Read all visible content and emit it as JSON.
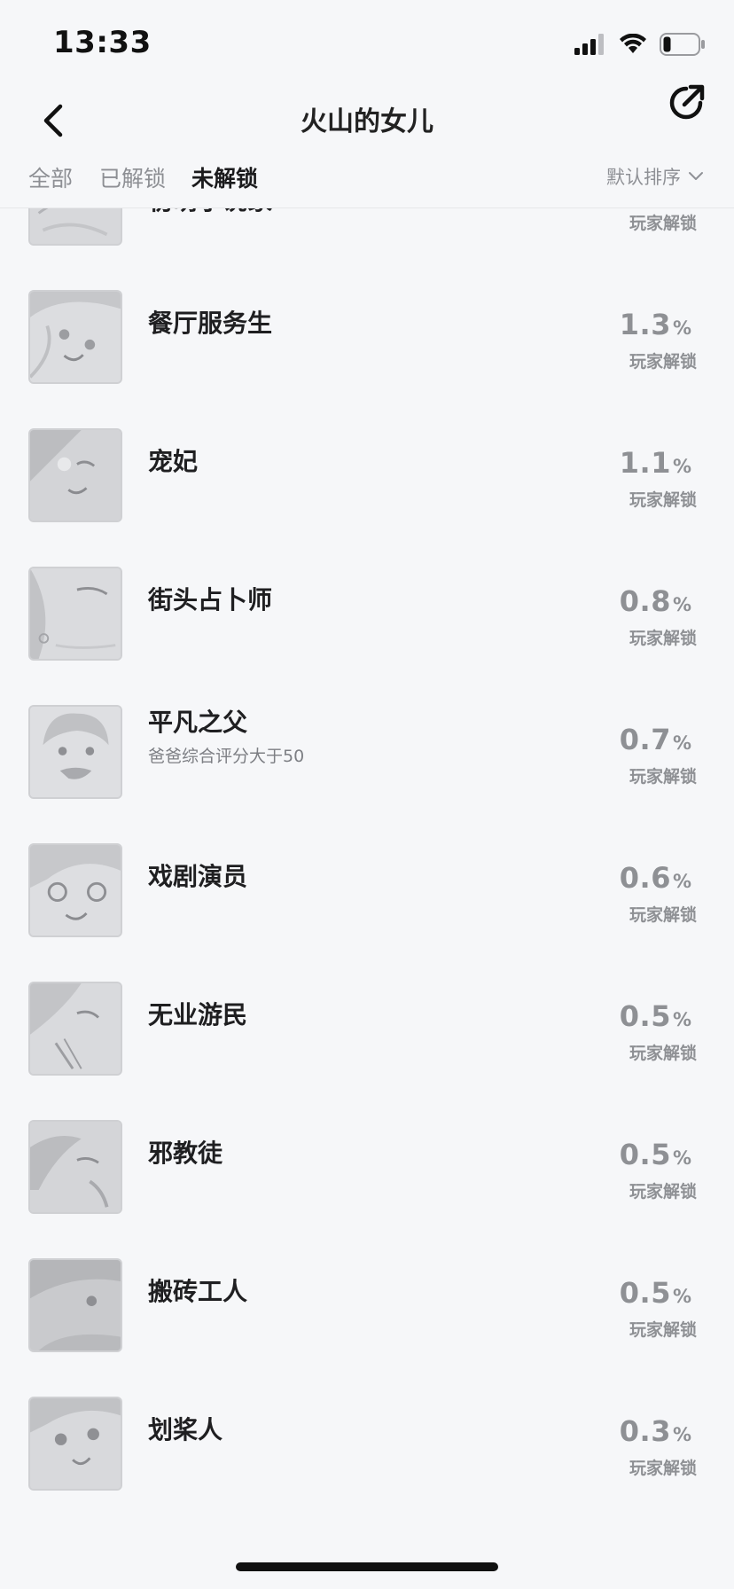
{
  "status_bar": {
    "time": "13:33"
  },
  "nav": {
    "title": "火山的女儿"
  },
  "tabs": [
    {
      "label": "全部"
    },
    {
      "label": "已解锁"
    },
    {
      "label": "未解锁"
    }
  ],
  "sort": {
    "label": "默认排序"
  },
  "list": {
    "unlock_label": "玩家解锁",
    "percent_unit": "%",
    "partial_item": {
      "name": "初萌小说家"
    },
    "items": [
      {
        "name": "餐厅服务生",
        "subtitle": "",
        "percent": "1.3"
      },
      {
        "name": "宠妃",
        "subtitle": "",
        "percent": "1.1"
      },
      {
        "name": "街头占卜师",
        "subtitle": "",
        "percent": "0.8"
      },
      {
        "name": "平凡之父",
        "subtitle": "爸爸综合评分大于50",
        "percent": "0.7"
      },
      {
        "name": "戏剧演员",
        "subtitle": "",
        "percent": "0.6"
      },
      {
        "name": "无业游民",
        "subtitle": "",
        "percent": "0.5"
      },
      {
        "name": "邪教徒",
        "subtitle": "",
        "percent": "0.5"
      },
      {
        "name": "搬砖工人",
        "subtitle": "",
        "percent": "0.5"
      },
      {
        "name": "划桨人",
        "subtitle": "",
        "percent": "0.3"
      }
    ]
  }
}
